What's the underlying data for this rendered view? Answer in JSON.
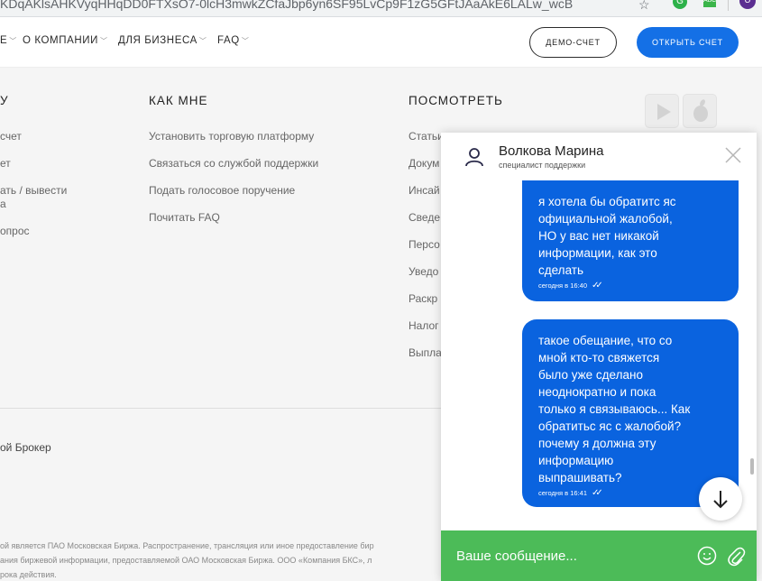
{
  "browser": {
    "url": "KDqAKlsAHKVyqHHqDD0FTXsO7-0lcH3mwkZCfaJbp6yn6SF95LvCp9F1zG5GFtJAaAkE6LALw_wcB",
    "ext_grammarly": "G",
    "ext_green": "АВС",
    "profile_initial": "U"
  },
  "header": {
    "nav": [
      {
        "label": "Е"
      },
      {
        "label": "О КОМПАНИИ"
      },
      {
        "label": "ДЛЯ БИЗНЕСА"
      },
      {
        "label": "FAQ"
      }
    ],
    "demo_label": "ДЕМО-СЧЕТ",
    "open_label": "ОТКРЫТЬ СЧЕТ"
  },
  "footer": {
    "col1": {
      "heading": "У",
      "links": [
        "счет",
        "ет",
        "ать / вывести",
        "а",
        "опрос"
      ]
    },
    "col2": {
      "heading": "КАК МНЕ",
      "links": [
        "Установить торговую платформу",
        "Связаться со службой поддержки",
        "Подать голосовое поручение",
        "Почитать FAQ"
      ]
    },
    "col3": {
      "heading": "ПОСМОТРЕТЬ",
      "links": [
        "Статьи",
        "Докум",
        "Инсай",
        "Сведе",
        "Персо",
        "Уведо",
        "Раскр",
        "Налог",
        "Выпла"
      ]
    },
    "broker": "ой Брокер",
    "legal": [
      "ой является ПАО Московская Биржа. Распространение, трансляция или иное предоставление бир",
      "ания биржевой информации, предоставляемой ОАО Московская Биржа. ООО «Компания БКС», л",
      "рока действия."
    ]
  },
  "chat": {
    "agent_name": "Волкова Марина",
    "agent_role": "специалист поддержки",
    "messages": [
      {
        "text": "я хотела бы обратитс яс\nофициальной жалобой,\nНО у вас нет никакой\nинформации, как это\nсделать",
        "time": "сегодня в 16:40"
      },
      {
        "text": "такое обещание, что со\nмной кто-то свяжется\nбыло уже сделано\nнеоднократно и пока\nтолько я связываюсь... Как\nобратитьс яс  с жалобой?\nпочему я должна эту\nинформацию\nвыпрашивать?",
        "time": "сегодня в 16:41"
      }
    ],
    "input_placeholder": "Ваше сообщение...",
    "colors": {
      "bubble": "#0a63df",
      "composer": "#4cbb58",
      "primary_button": "#1470e6"
    }
  }
}
